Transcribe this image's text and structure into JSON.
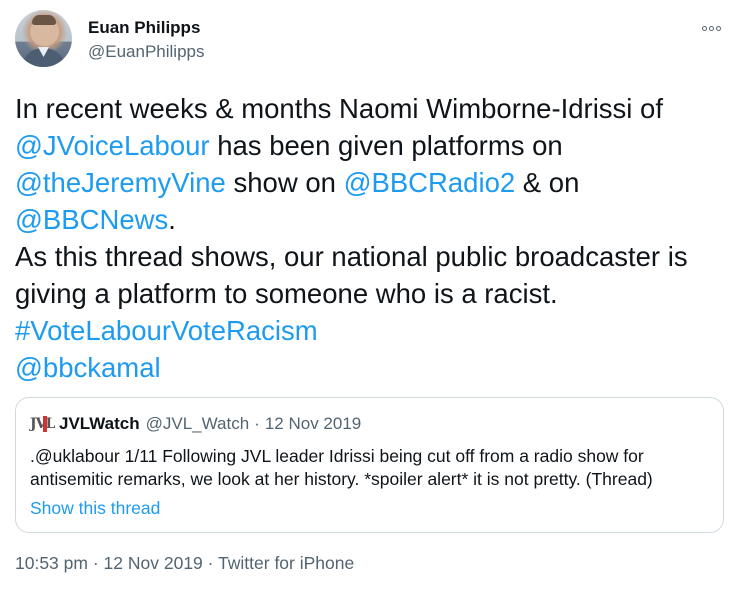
{
  "author": {
    "name": "Euan Philipps",
    "handle": "@EuanPhilipps"
  },
  "icons": {
    "more": "more-options-icon",
    "avatar": "avatar",
    "quoted_logo": "jvl-logo"
  },
  "tweet": {
    "t1": "In recent weeks & months Naomi Wimborne-Idrissi of ",
    "m1": "@JVoiceLabour",
    "t2": " has been given platforms on ",
    "m2": "@theJeremyVine",
    "t3": " show on ",
    "m3": "@BBCRadio2",
    "t4": " & on ",
    "m4": "@BBCNews",
    "t5": ".",
    "t6": "As this thread shows, our national public broadcaster is giving a platform to someone who is a racist.",
    "hashtag": "#VoteLabourVoteRacism",
    "m5": "@bbckamal"
  },
  "quoted": {
    "logo_text": "JVL",
    "name": "JVLWatch",
    "handle": "@JVL_Watch",
    "separator": "·",
    "date": "12 Nov 2019",
    "text": ".@uklabour 1/11 Following JVL leader Idrissi being cut off from a radio show for antisemitic remarks, we look at her history. *spoiler alert* it is not pretty. (Thread)",
    "show_thread": "Show this thread"
  },
  "footer": {
    "time": "10:53 pm",
    "sep1": "·",
    "date": "12 Nov 2019",
    "sep2": "·",
    "source": "Twitter for iPhone"
  },
  "colors": {
    "link": "#1d9bf0",
    "text": "#0f1419",
    "secondary": "#536471",
    "border": "#cfd9de"
  }
}
